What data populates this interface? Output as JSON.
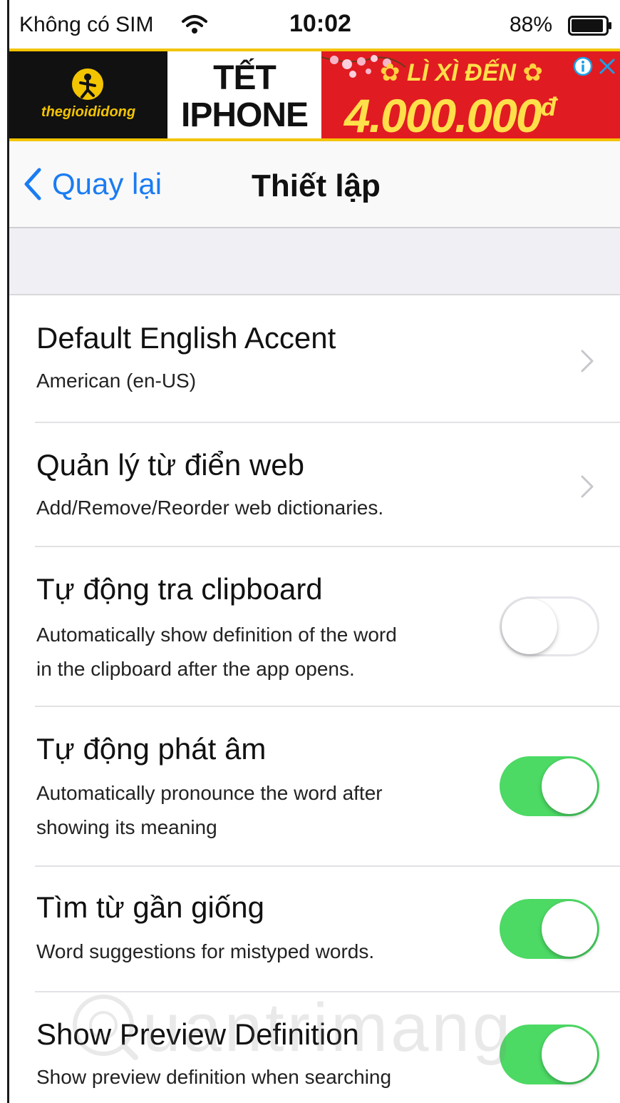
{
  "status_bar": {
    "carrier": "Không có SIM",
    "time": "10:02",
    "battery_pct": "88%"
  },
  "ad": {
    "brand": "thegioididong",
    "line1": "TẾT",
    "line2": "IPHONE",
    "promo_top": "LÌ XÌ ĐẾN",
    "promo_amount": "4.000.000",
    "promo_currency": "đ",
    "accent_yellow": "#f3c400",
    "accent_red": "#e11b22"
  },
  "nav": {
    "back_label": "Quay lại",
    "title": "Thiết lập",
    "accent": "#1a7cf3"
  },
  "settings": [
    {
      "title": "Default English Accent",
      "subtitle": "American (en-US)",
      "control": "chevron"
    },
    {
      "title": "Quản lý từ điển web",
      "subtitle": "Add/Remove/Reorder web dictionaries.",
      "control": "chevron"
    },
    {
      "title": "Tự động tra clipboard",
      "subtitle_line1": "Automatically show definition of the word",
      "subtitle_line2": "in the clipboard after the app opens.",
      "control": "toggle",
      "state": "off"
    },
    {
      "title": "Tự động phát âm",
      "subtitle_line1": "Automatically pronounce the word after",
      "subtitle_line2": "showing its meaning",
      "control": "toggle",
      "state": "on"
    },
    {
      "title": "Tìm từ gần giống",
      "subtitle": "Word suggestions for mistyped words.",
      "control": "toggle",
      "state": "on"
    },
    {
      "title": "Show Preview Definition",
      "subtitle": "Show preview definition when searching",
      "control": "toggle",
      "state": "on"
    }
  ],
  "watermark": "uantrimang",
  "toggle_on_color": "#4cd964"
}
